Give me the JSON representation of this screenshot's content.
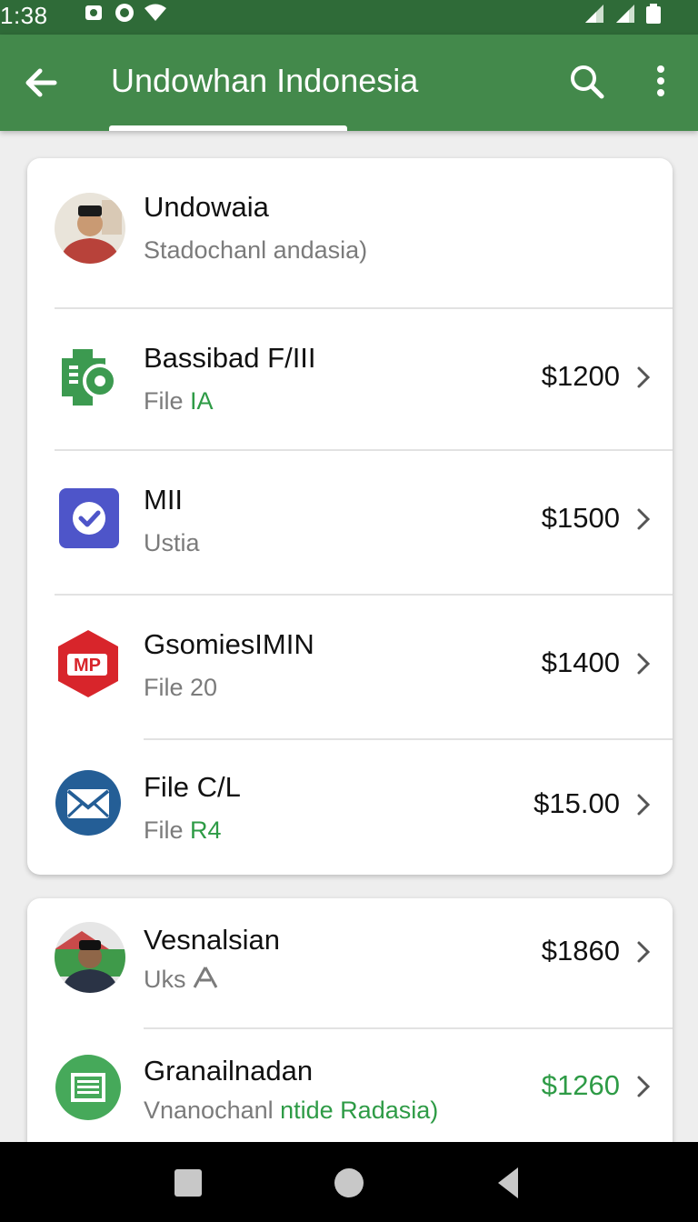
{
  "status_bar": {
    "time": "1:38",
    "icons": [
      "notification-icon",
      "message-icon",
      "wifi-icon",
      "signal-icon",
      "signal-icon",
      "battery-icon"
    ]
  },
  "app_bar": {
    "title": "Undowhan Indonesia",
    "back_icon": "arrow-left-icon",
    "search_icon": "search-icon",
    "more_icon": "more-vert-icon",
    "color": "#43894b"
  },
  "profile": {
    "name": "Undowaia",
    "subtitle": "Stadochanl andasia)"
  },
  "items": [
    {
      "title": "Bassibad F/III",
      "sub_prefix": "File ",
      "sub_highlight": "IA",
      "amount": "$1200",
      "icon": "green-gear-doc-icon"
    },
    {
      "title": "MII",
      "sub_prefix": "Ustia",
      "sub_highlight": "",
      "amount": "$1500",
      "icon": "blue-check-icon"
    },
    {
      "title": "GsomiesIMIN",
      "sub_prefix": "File 20",
      "sub_highlight": "",
      "amount": "$1400",
      "icon": "red-mp-hexagon-icon"
    },
    {
      "title": "File C/L",
      "sub_prefix": "File ",
      "sub_highlight": "R4",
      "amount": "$15.00",
      "icon": "mail-icon"
    }
  ],
  "second_card": [
    {
      "title": "Vesnalsian",
      "sub_prefix": "Uks ",
      "sub_highlight": "",
      "amount": "$1860",
      "icon": "avatar-photo",
      "accent": "#111111"
    },
    {
      "title": "Granailnadan",
      "sub_prefix": "Vnanochanl ",
      "sub_highlight": "ntide Radasia)",
      "amount": "$1260",
      "icon": "green-document-icon",
      "accent": "#2e9b46"
    }
  ],
  "colors": {
    "status_bar": "#2f6b38",
    "accent_green": "#2e9b46"
  }
}
